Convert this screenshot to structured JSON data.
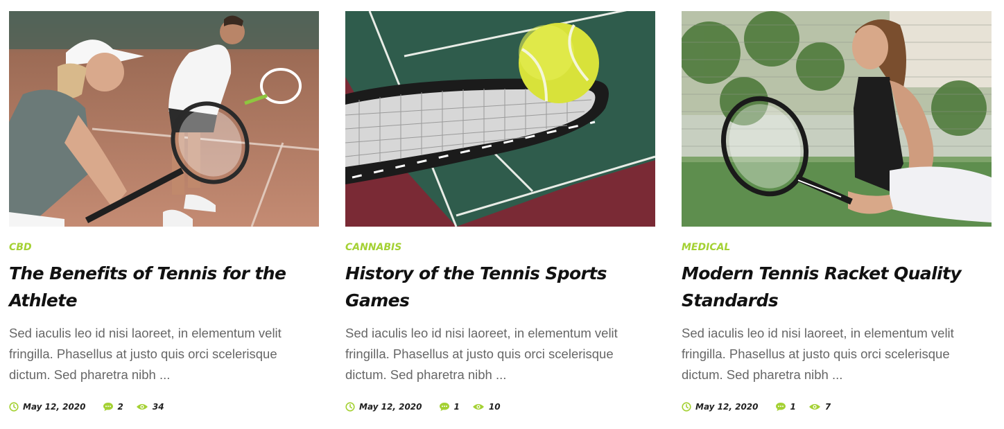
{
  "colors": {
    "accent": "#a4d133",
    "title": "#111111",
    "excerpt": "#666666"
  },
  "posts": [
    {
      "category": "CBD",
      "title": "The Benefits of Tennis for the Athlete",
      "excerpt": "Sed iaculis leo id nisi laoreet, in elementum velit fringilla. Phasellus at justo quis orci scelerisque dictum. Sed pharetra nibh ...",
      "date": "May 12, 2020",
      "comments": "2",
      "views": "34",
      "image_icon": "tennis-doubles-players-image"
    },
    {
      "category": "CANNABIS",
      "title": "History of the Tennis Sports Games",
      "excerpt": "Sed iaculis leo id nisi laoreet, in elementum velit fringilla. Phasellus at justo quis orci scelerisque dictum. Sed pharetra nibh ...",
      "date": "May 12, 2020",
      "comments": "1",
      "views": "10",
      "image_icon": "tennis-racket-ball-image"
    },
    {
      "category": "MEDICAL",
      "title": "Modern Tennis Racket Quality Standards",
      "excerpt": "Sed iaculis leo id nisi laoreet, in elementum velit fringilla. Phasellus at justo quis orci scelerisque dictum. Sed pharetra nibh ...",
      "date": "May 12, 2020",
      "comments": "1",
      "views": "7",
      "image_icon": "tennis-player-woman-image"
    }
  ],
  "icons": {
    "date": "clock-icon",
    "comments": "comment-bubble-icon",
    "views": "eye-icon"
  }
}
